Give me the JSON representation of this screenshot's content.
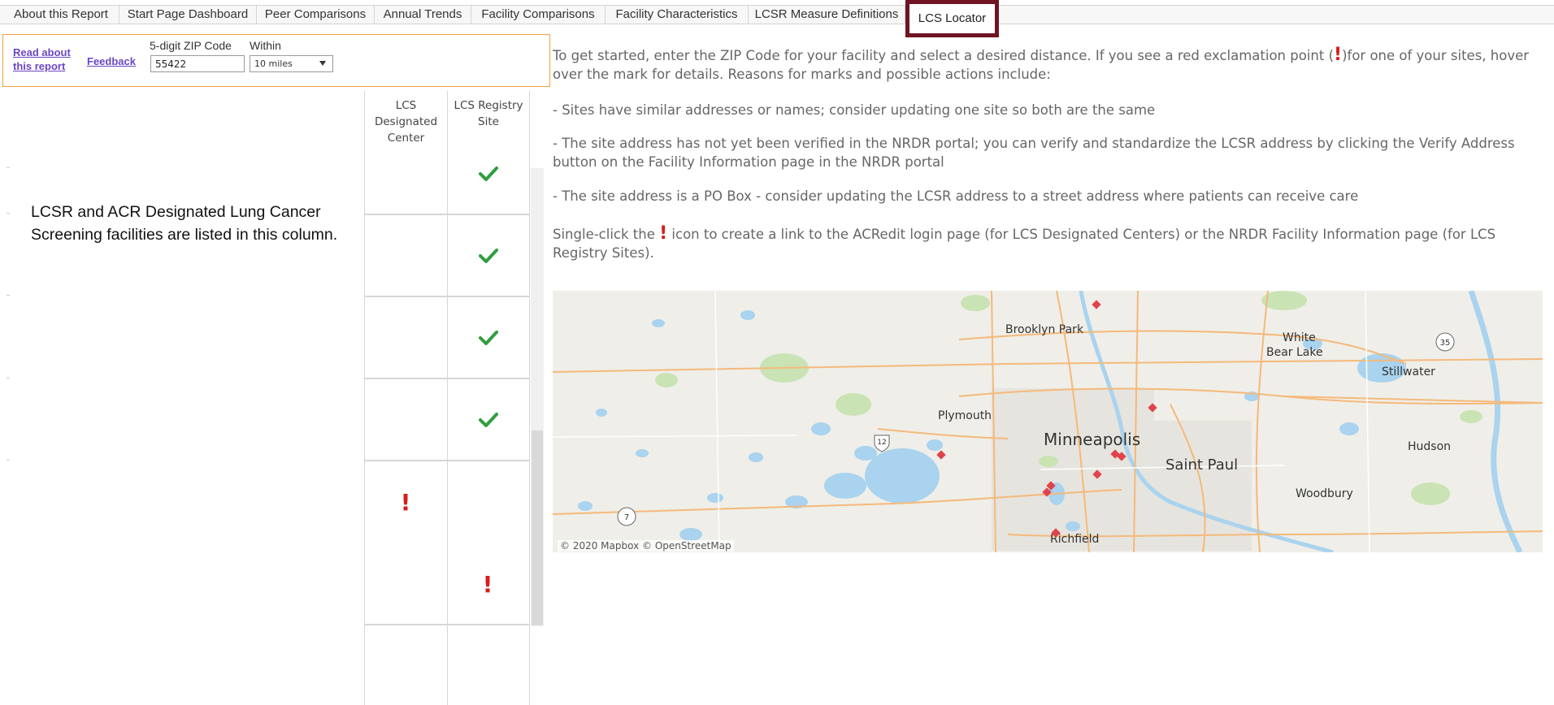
{
  "tabs": [
    {
      "label": "About this Report"
    },
    {
      "label": "Start Page Dashboard"
    },
    {
      "label": "Peer Comparisons"
    },
    {
      "label": "Annual Trends"
    },
    {
      "label": "Facility Comparisons"
    },
    {
      "label": "Facility Characteristics"
    },
    {
      "label": "LCSR Measure Definitions"
    },
    {
      "label": "LCS Locator"
    }
  ],
  "filters": {
    "read_about": "Read about this report",
    "feedback": "Feedback",
    "zip_label": "5-digit ZIP Code",
    "zip_value": "55422",
    "within_label": "Within",
    "within_value": "10 miles"
  },
  "note": "LCSR and ACR Designated Lung Cancer Screening facilities are listed in this column.",
  "table": {
    "col1_header": "LCS Designated Center",
    "col2_header": "LCS Registry Site",
    "rows": [
      {
        "designated": "",
        "registry": "check"
      },
      {
        "designated": "",
        "registry": "check"
      },
      {
        "designated": "",
        "registry": "check"
      },
      {
        "designated": "",
        "registry": "check"
      },
      {
        "designated": "!",
        "registry": "!"
      }
    ]
  },
  "instructions": {
    "intro_a": "To get started, enter the ZIP Code for your facility and select a desired distance. If you see a red exclamation point (",
    "intro_mark": "!",
    "intro_b": ")for one of your sites, hover over the mark for details. Reasons for marks and possible actions include:",
    "reason1": "- Sites have similar addresses or names; consider updating one site so both are the same",
    "reason2": "- The site address has not yet been verified in the NRDR portal; you can verify and standardize the LCSR address by clicking the Verify Address button on the Facility Information page in the NRDR portal",
    "reason3": "- The site address is a PO Box - consider updating the LCSR address to a street address where patients can receive care",
    "single_a": "Single-click the ",
    "single_mark": "!",
    "single_b": " icon to create a link to the ACRedit login page (for LCS Designated Centers) or the NRDR Facility Information page (for LCS Registry Sites)."
  },
  "map": {
    "places": {
      "brooklyn_park": "Brooklyn Park",
      "white_bear_lake_1": "White",
      "white_bear_lake_2": "Bear Lake",
      "stillwater": "Stillwater",
      "plymouth": "Plymouth",
      "minneapolis": "Minneapolis",
      "saint_paul": "Saint Paul",
      "hudson": "Hudson",
      "woodbury": "Woodbury",
      "richfield": "Richfield",
      "shield_12": "12",
      "shield_35": "35",
      "shield_7": "7"
    },
    "attribution": "© 2020 Mapbox © OpenStreetMap",
    "colors": {
      "water": "#a9d3ee",
      "park": "#c9e3b4",
      "road": "#f5b97a",
      "urban": "#e4e2dc",
      "marker": "#e0434c"
    }
  }
}
